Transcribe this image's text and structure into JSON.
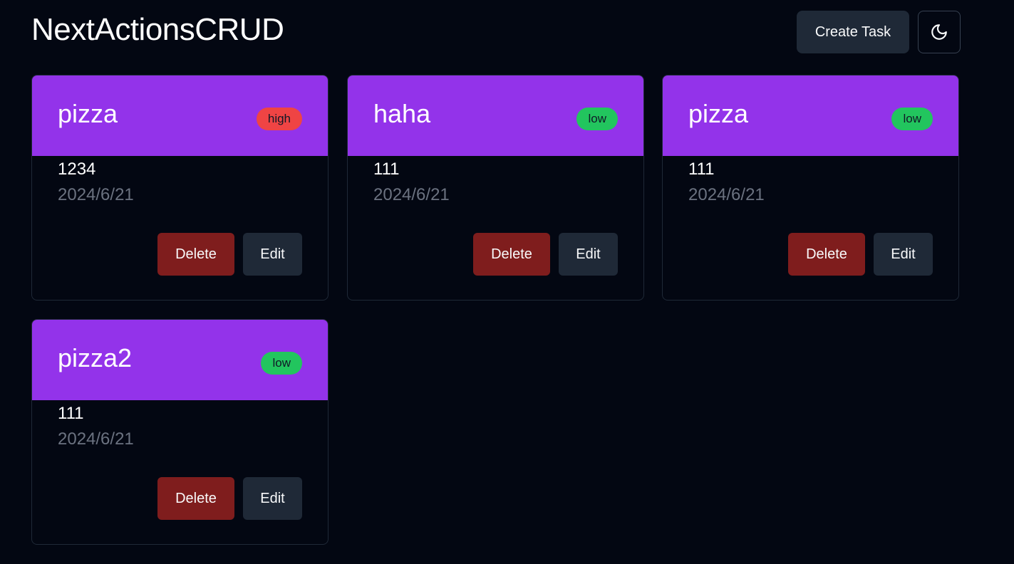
{
  "app": {
    "title": "NextActionsCRUD"
  },
  "header": {
    "create_label": "Create Task",
    "theme_icon": "moon-icon"
  },
  "colors": {
    "background": "#030712",
    "card_header": "#9333ea",
    "badge_high": "#ef4444",
    "badge_low": "#22c55e",
    "delete_button": "#7f1d1d",
    "edit_button": "#1f2937",
    "date_text": "#6b7280"
  },
  "tasks": [
    {
      "title": "pizza",
      "priority": "high",
      "description": "1234",
      "date": "2024/6/21",
      "delete_label": "Delete",
      "edit_label": "Edit"
    },
    {
      "title": "haha",
      "priority": "low",
      "description": "111",
      "date": "2024/6/21",
      "delete_label": "Delete",
      "edit_label": "Edit"
    },
    {
      "title": "pizza",
      "priority": "low",
      "description": "111",
      "date": "2024/6/21",
      "delete_label": "Delete",
      "edit_label": "Edit"
    },
    {
      "title": "pizza2",
      "priority": "low",
      "description": "111",
      "date": "2024/6/21",
      "delete_label": "Delete",
      "edit_label": "Edit"
    }
  ]
}
